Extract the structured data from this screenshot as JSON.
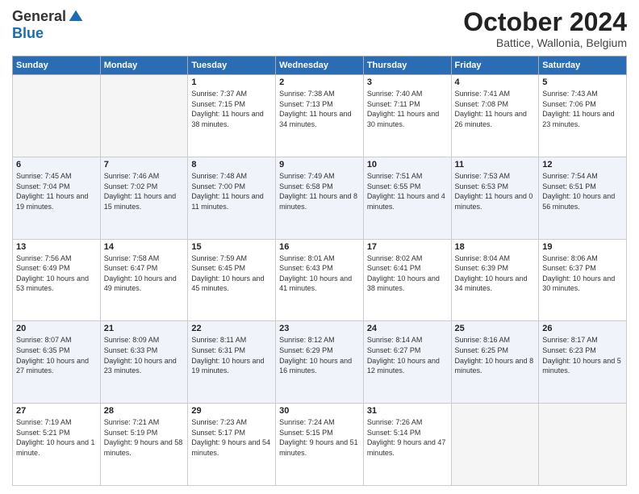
{
  "header": {
    "logo_general": "General",
    "logo_blue": "Blue",
    "month_title": "October 2024",
    "subtitle": "Battice, Wallonia, Belgium"
  },
  "days_of_week": [
    "Sunday",
    "Monday",
    "Tuesday",
    "Wednesday",
    "Thursday",
    "Friday",
    "Saturday"
  ],
  "weeks": [
    [
      {
        "day": "",
        "info": ""
      },
      {
        "day": "",
        "info": ""
      },
      {
        "day": "1",
        "info": "Sunrise: 7:37 AM\nSunset: 7:15 PM\nDaylight: 11 hours and 38 minutes."
      },
      {
        "day": "2",
        "info": "Sunrise: 7:38 AM\nSunset: 7:13 PM\nDaylight: 11 hours and 34 minutes."
      },
      {
        "day": "3",
        "info": "Sunrise: 7:40 AM\nSunset: 7:11 PM\nDaylight: 11 hours and 30 minutes."
      },
      {
        "day": "4",
        "info": "Sunrise: 7:41 AM\nSunset: 7:08 PM\nDaylight: 11 hours and 26 minutes."
      },
      {
        "day": "5",
        "info": "Sunrise: 7:43 AM\nSunset: 7:06 PM\nDaylight: 11 hours and 23 minutes."
      }
    ],
    [
      {
        "day": "6",
        "info": "Sunrise: 7:45 AM\nSunset: 7:04 PM\nDaylight: 11 hours and 19 minutes."
      },
      {
        "day": "7",
        "info": "Sunrise: 7:46 AM\nSunset: 7:02 PM\nDaylight: 11 hours and 15 minutes."
      },
      {
        "day": "8",
        "info": "Sunrise: 7:48 AM\nSunset: 7:00 PM\nDaylight: 11 hours and 11 minutes."
      },
      {
        "day": "9",
        "info": "Sunrise: 7:49 AM\nSunset: 6:58 PM\nDaylight: 11 hours and 8 minutes."
      },
      {
        "day": "10",
        "info": "Sunrise: 7:51 AM\nSunset: 6:55 PM\nDaylight: 11 hours and 4 minutes."
      },
      {
        "day": "11",
        "info": "Sunrise: 7:53 AM\nSunset: 6:53 PM\nDaylight: 11 hours and 0 minutes."
      },
      {
        "day": "12",
        "info": "Sunrise: 7:54 AM\nSunset: 6:51 PM\nDaylight: 10 hours and 56 minutes."
      }
    ],
    [
      {
        "day": "13",
        "info": "Sunrise: 7:56 AM\nSunset: 6:49 PM\nDaylight: 10 hours and 53 minutes."
      },
      {
        "day": "14",
        "info": "Sunrise: 7:58 AM\nSunset: 6:47 PM\nDaylight: 10 hours and 49 minutes."
      },
      {
        "day": "15",
        "info": "Sunrise: 7:59 AM\nSunset: 6:45 PM\nDaylight: 10 hours and 45 minutes."
      },
      {
        "day": "16",
        "info": "Sunrise: 8:01 AM\nSunset: 6:43 PM\nDaylight: 10 hours and 41 minutes."
      },
      {
        "day": "17",
        "info": "Sunrise: 8:02 AM\nSunset: 6:41 PM\nDaylight: 10 hours and 38 minutes."
      },
      {
        "day": "18",
        "info": "Sunrise: 8:04 AM\nSunset: 6:39 PM\nDaylight: 10 hours and 34 minutes."
      },
      {
        "day": "19",
        "info": "Sunrise: 8:06 AM\nSunset: 6:37 PM\nDaylight: 10 hours and 30 minutes."
      }
    ],
    [
      {
        "day": "20",
        "info": "Sunrise: 8:07 AM\nSunset: 6:35 PM\nDaylight: 10 hours and 27 minutes."
      },
      {
        "day": "21",
        "info": "Sunrise: 8:09 AM\nSunset: 6:33 PM\nDaylight: 10 hours and 23 minutes."
      },
      {
        "day": "22",
        "info": "Sunrise: 8:11 AM\nSunset: 6:31 PM\nDaylight: 10 hours and 19 minutes."
      },
      {
        "day": "23",
        "info": "Sunrise: 8:12 AM\nSunset: 6:29 PM\nDaylight: 10 hours and 16 minutes."
      },
      {
        "day": "24",
        "info": "Sunrise: 8:14 AM\nSunset: 6:27 PM\nDaylight: 10 hours and 12 minutes."
      },
      {
        "day": "25",
        "info": "Sunrise: 8:16 AM\nSunset: 6:25 PM\nDaylight: 10 hours and 8 minutes."
      },
      {
        "day": "26",
        "info": "Sunrise: 8:17 AM\nSunset: 6:23 PM\nDaylight: 10 hours and 5 minutes."
      }
    ],
    [
      {
        "day": "27",
        "info": "Sunrise: 7:19 AM\nSunset: 5:21 PM\nDaylight: 10 hours and 1 minute."
      },
      {
        "day": "28",
        "info": "Sunrise: 7:21 AM\nSunset: 5:19 PM\nDaylight: 9 hours and 58 minutes."
      },
      {
        "day": "29",
        "info": "Sunrise: 7:23 AM\nSunset: 5:17 PM\nDaylight: 9 hours and 54 minutes."
      },
      {
        "day": "30",
        "info": "Sunrise: 7:24 AM\nSunset: 5:15 PM\nDaylight: 9 hours and 51 minutes."
      },
      {
        "day": "31",
        "info": "Sunrise: 7:26 AM\nSunset: 5:14 PM\nDaylight: 9 hours and 47 minutes."
      },
      {
        "day": "",
        "info": ""
      },
      {
        "day": "",
        "info": ""
      }
    ]
  ]
}
